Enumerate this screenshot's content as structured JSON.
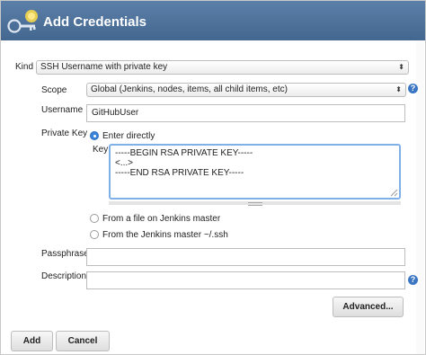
{
  "dialog": {
    "title": "Add Credentials",
    "logo_icon": "jenkins-key-logo"
  },
  "form": {
    "kind_label": "Kind",
    "kind_value": "SSH Username with private key",
    "scope_label": "Scope",
    "scope_value": "Global (Jenkins, nodes, items, all child items, etc)",
    "username_label": "Username",
    "username_value": "GitHubUser",
    "private_key_label": "Private Key",
    "enter_directly_label": "Enter directly",
    "key_label": "Key",
    "key_lines": [
      "-----BEGIN RSA PRIVATE KEY-----",
      "<...>",
      "-----END RSA PRIVATE KEY-----"
    ],
    "from_file_label": "From a file on Jenkins master",
    "from_ssh_label": "From the Jenkins master ~/.ssh",
    "passphrase_label": "Passphrase",
    "passphrase_value": "",
    "description_label": "Description",
    "description_value": "",
    "advanced_label": "Advanced...",
    "help_glyph": "?"
  },
  "footer": {
    "add_label": "Add",
    "cancel_label": "Cancel"
  },
  "colors": {
    "header": "#4f739c",
    "radio_selected": "#3b83d9",
    "focus_border": "#7fb0e8"
  }
}
